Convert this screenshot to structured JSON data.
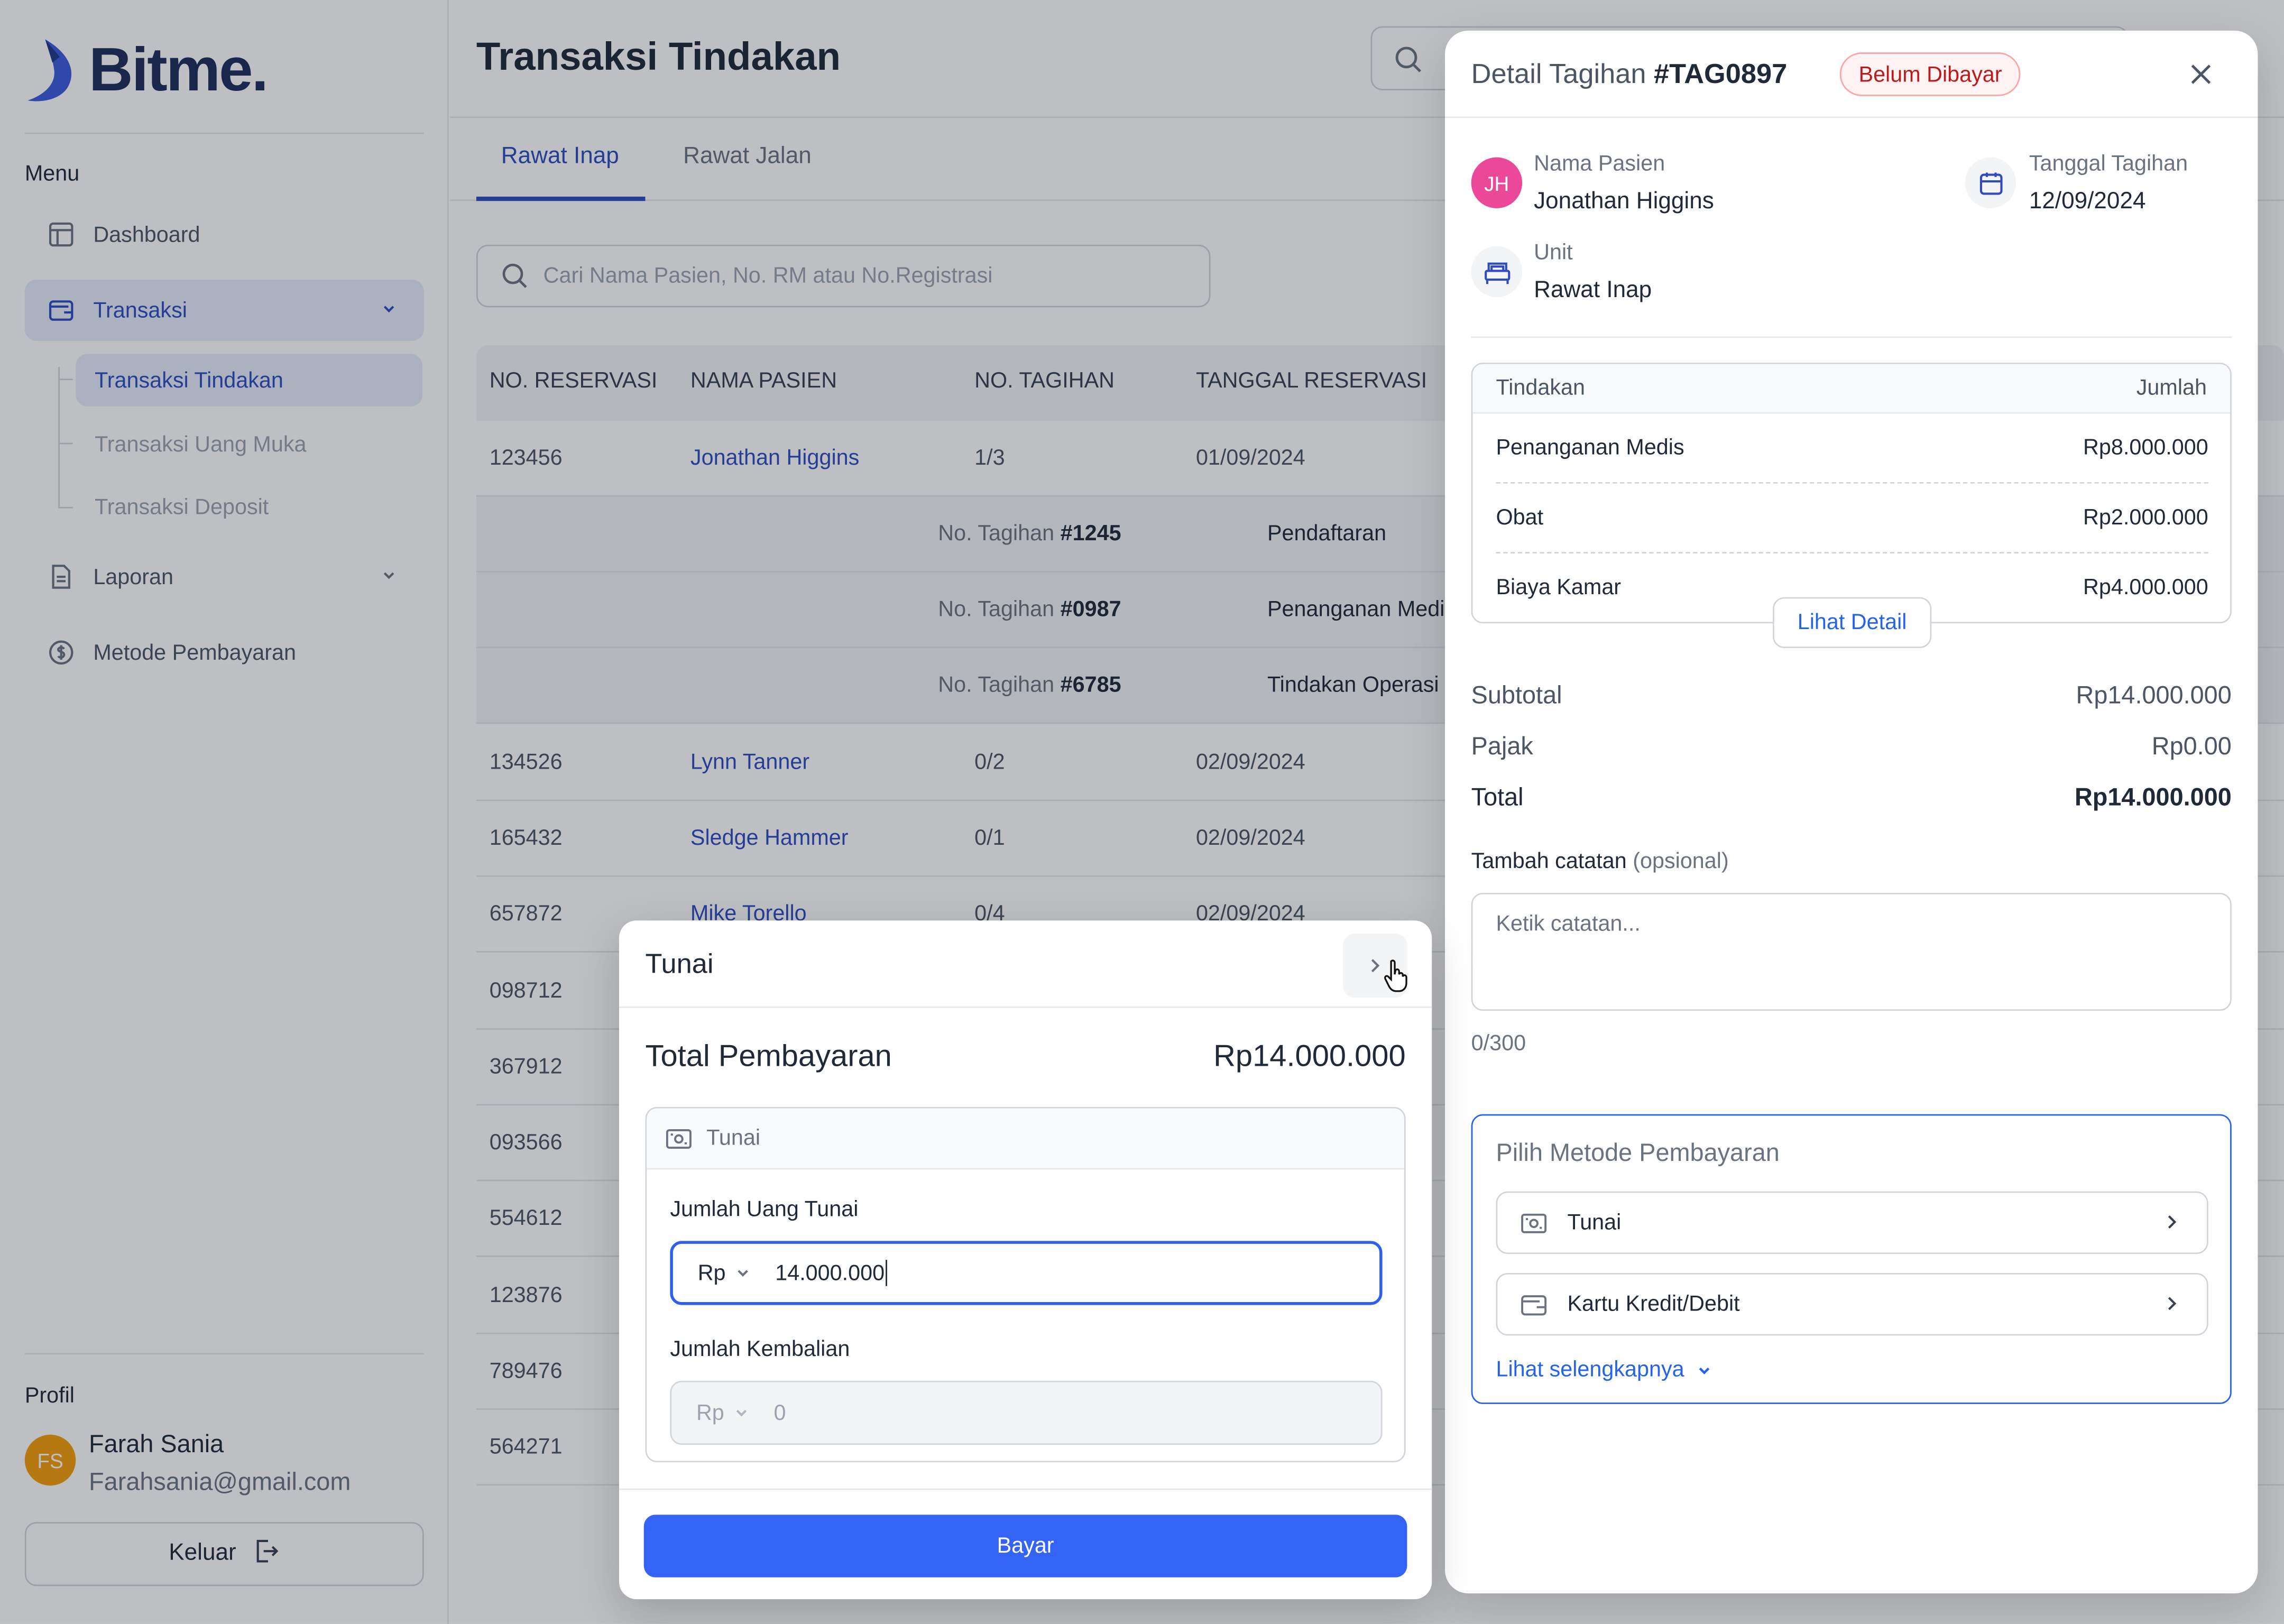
{
  "app": {
    "logo_text": "Bitme."
  },
  "sidebar": {
    "menu_label": "Menu",
    "items": [
      {
        "label": "Dashboard",
        "icon": "layout-icon"
      },
      {
        "label": "Transaksi",
        "icon": "wallet-icon"
      },
      {
        "label": "Laporan",
        "icon": "document-icon"
      },
      {
        "label": "Metode Pembayaran",
        "icon": "dollar-circle-icon"
      }
    ],
    "sub_items": [
      "Transaksi Tindakan",
      "Transaksi Uang Muka",
      "Transaksi Deposit"
    ],
    "profile_label": "Profil",
    "user": {
      "initials": "FS",
      "name": "Farah Sania",
      "email": "Farahsania@gmail.com"
    },
    "logout_label": "Keluar"
  },
  "main": {
    "title": "Transaksi Tindakan",
    "tabs": [
      "Rawat Inap",
      "Rawat Jalan"
    ],
    "search_placeholder": "Cari Nama Pasien, No. RM atau No.Registrasi",
    "columns": [
      "NO. RESERVASI",
      "NAMA PASIEN",
      "NO. TAGIHAN",
      "TANGGAL RESERVASI"
    ],
    "rows": [
      {
        "reservasi": "123456",
        "nama": "Jonathan Higgins",
        "tagihan": "1/3",
        "tanggal": "01/09/2024"
      },
      {
        "reservasi": "134526",
        "nama": "Lynn Tanner",
        "tagihan": "0/2",
        "tanggal": "02/09/2024"
      },
      {
        "reservasi": "165432",
        "nama": "Sledge Hammer",
        "tagihan": "0/1",
        "tanggal": "02/09/2024"
      },
      {
        "reservasi": "657872",
        "nama": "Mike Torello",
        "tagihan": "0/4",
        "tanggal": "02/09/2024"
      },
      {
        "reservasi": "098712"
      },
      {
        "reservasi": "367912"
      },
      {
        "reservasi": "093566"
      },
      {
        "reservasi": "554612"
      },
      {
        "reservasi": "123876"
      },
      {
        "reservasi": "789476"
      },
      {
        "reservasi": "564271"
      }
    ],
    "sub_rows": [
      {
        "label": "No. Tagihan",
        "number": "#1245",
        "desc": "Pendaftaran"
      },
      {
        "label": "No. Tagihan",
        "number": "#0987",
        "desc": "Penanganan Medis"
      },
      {
        "label": "No. Tagihan",
        "number": "#6785",
        "desc": "Tindakan Operasi"
      }
    ]
  },
  "drawer": {
    "title": "Detail Tagihan",
    "tag_id": "#TAG0897",
    "status": "Belum Dibayar",
    "patient": {
      "initials": "JH",
      "label": "Nama Pasien",
      "value": "Jonathan Higgins"
    },
    "date": {
      "label": "Tanggal Tagihan",
      "value": "12/09/2024"
    },
    "unit": {
      "label": "Unit",
      "value": "Rawat Inap"
    },
    "table": {
      "col_action": "Tindakan",
      "col_amount": "Jumlah",
      "items": [
        {
          "name": "Penanganan Medis",
          "amount": "Rp8.000.000"
        },
        {
          "name": "Obat",
          "amount": "Rp2.000.000"
        },
        {
          "name": "Biaya Kamar",
          "amount": "Rp4.000.000"
        }
      ],
      "detail_button": "Lihat Detail"
    },
    "summary": {
      "subtotal_label": "Subtotal",
      "subtotal": "Rp14.000.000",
      "tax_label": "Pajak",
      "tax": "Rp0.00",
      "total_label": "Total",
      "total": "Rp14.000.000"
    },
    "note": {
      "label": "Tambah catatan",
      "optional": "(opsional)",
      "placeholder": "Ketik catatan...",
      "counter": "0/300"
    },
    "payment": {
      "title": "Pilih Metode Pembayaran",
      "options": [
        {
          "label": "Tunai",
          "icon": "cash-icon"
        },
        {
          "label": "Kartu Kredit/Debit",
          "icon": "card-wallet-icon"
        }
      ],
      "more": "Lihat selengkapnya"
    }
  },
  "modal": {
    "title": "Tunai",
    "total_label": "Total Pembayaran",
    "total_value": "Rp14.000.000",
    "method": "Tunai",
    "cash_label": "Jumlah Uang Tunai",
    "currency": "Rp",
    "cash_value": "14.000.000",
    "change_label": "Jumlah Kembalian",
    "change_value": "0",
    "pay_button": "Bayar"
  },
  "colors": {
    "primary": "#3563f5",
    "accent": "#2f4bbf",
    "danger": "#b91c1c"
  }
}
